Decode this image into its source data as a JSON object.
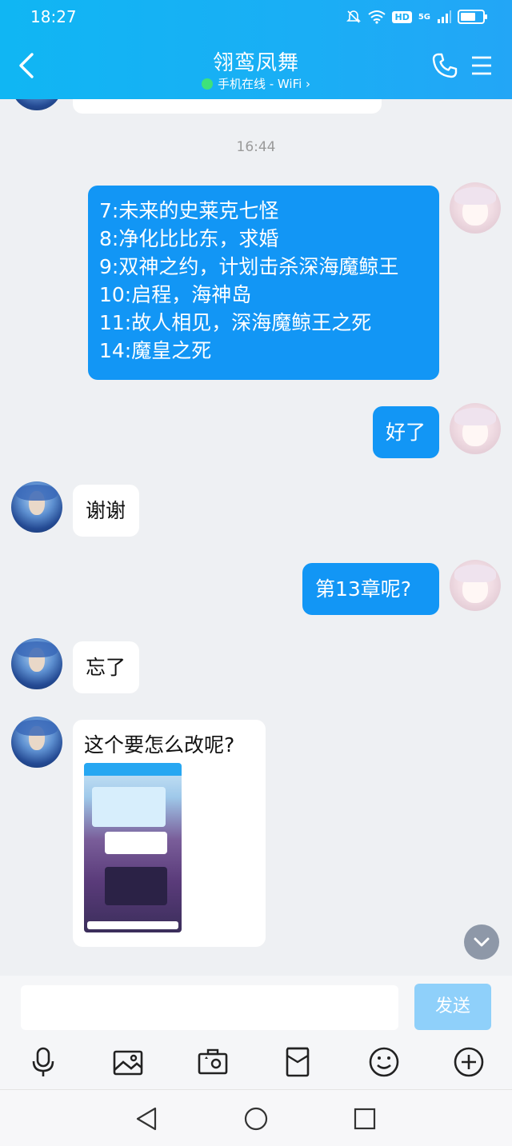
{
  "status_bar": {
    "time": "18:27",
    "hd": "HD",
    "network": "5G",
    "battery_level": 0.7
  },
  "header": {
    "title": "翎鸾凤舞",
    "subtitle": "手机在线 - WiFi ›",
    "online_color": "#3ee27a"
  },
  "chat": {
    "timestamp": "16:44",
    "long_message_lines": [
      "7:未来的史莱克七怪",
      "8:净化比比东，求婚",
      "9:双神之约，计划击杀深海魔鲸王",
      "10:启程，海神岛",
      "11:故人相见，深海魔鲸王之死",
      "14:魔皇之死"
    ],
    "msg_ok": "好了",
    "msg_thanks": "谢谢",
    "msg_ch13": "第13章呢?",
    "msg_forgot": "忘了",
    "msg_how": "这个要怎么改呢?"
  },
  "input": {
    "placeholder": "",
    "send_label": "发送"
  },
  "toolbar": [
    "mic-icon",
    "image-icon",
    "camera-icon",
    "red-packet-icon",
    "emoji-icon",
    "plus-icon"
  ],
  "colors": {
    "accent": "#1296f5",
    "header": "#1aaef5",
    "send_disabled": "#8fd0fa"
  }
}
